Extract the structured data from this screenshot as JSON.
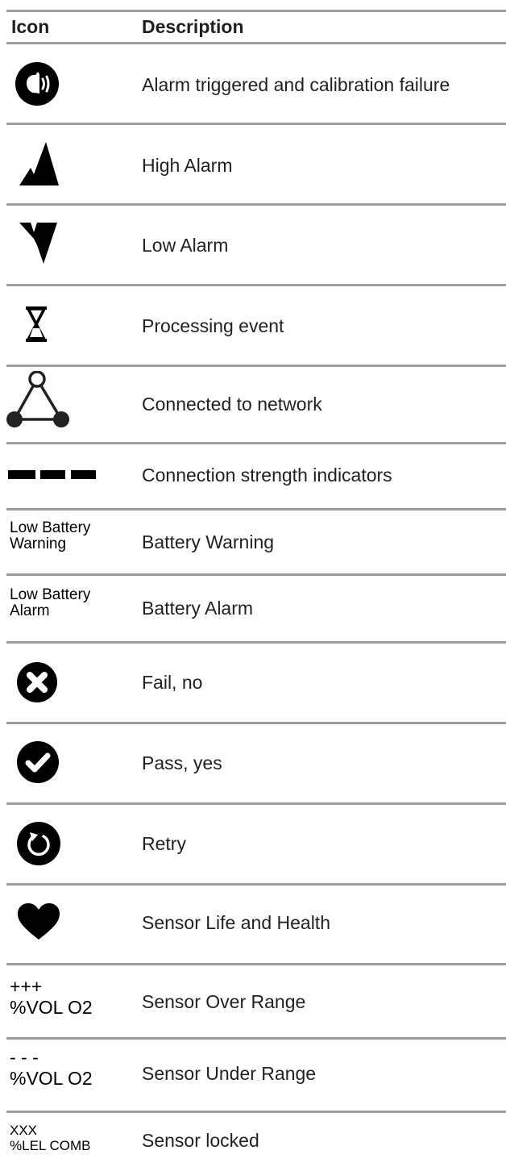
{
  "header": {
    "icon_col": "Icon",
    "description_col": "Description"
  },
  "rows": [
    {
      "icon": "alarm-speaker-icon",
      "description": "Alarm triggered and calibration failure"
    },
    {
      "icon": "high-alarm-icon",
      "description": "High Alarm"
    },
    {
      "icon": "low-alarm-icon",
      "description": "Low Alarm"
    },
    {
      "icon": "hourglass-icon",
      "description": "Processing event"
    },
    {
      "icon": "network-triangle-icon",
      "description": "Connected to network"
    },
    {
      "icon": "connection-dashes-icon",
      "description": "Connection strength indicators"
    },
    {
      "icon_text": [
        "Low Battery",
        "Warning"
      ],
      "description": "Battery Warning"
    },
    {
      "icon_text": [
        "Low Battery",
        "Alarm"
      ],
      "description": "Battery Alarm"
    },
    {
      "icon": "x-circle-icon",
      "description": "Fail, no"
    },
    {
      "icon": "check-circle-icon",
      "description": "Pass, yes"
    },
    {
      "icon": "retry-icon",
      "description": "Retry"
    },
    {
      "icon": "heart-icon",
      "description": "Sensor Life and Health"
    },
    {
      "icon_text": [
        "+++",
        "%VOL O2"
      ],
      "description": "Sensor Over Range"
    },
    {
      "icon_text": [
        "- - -",
        "%VOL O2"
      ],
      "description": "Sensor Under Range"
    },
    {
      "icon_text": [
        "XXX",
        "%LEL COMB"
      ],
      "description": "Sensor locked"
    }
  ]
}
